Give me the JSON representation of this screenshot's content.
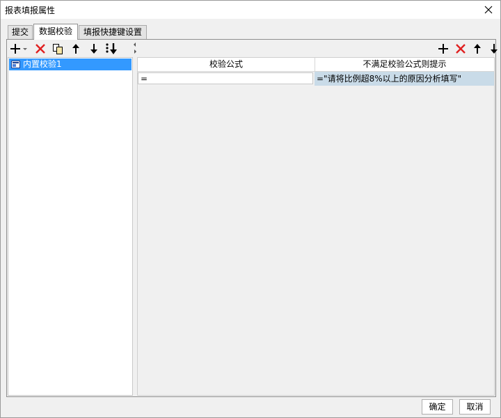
{
  "window": {
    "title": "报表填报属性"
  },
  "tabs": [
    {
      "label": "提交",
      "active": false
    },
    {
      "label": "数据校验",
      "active": true
    },
    {
      "label": "填报快捷键设置",
      "active": false
    }
  ],
  "left_toolbar": {
    "icons": [
      "add-icon",
      "delete-icon",
      "copy-icon",
      "move-up-icon",
      "move-down-icon",
      "move-to-bottom-icon"
    ]
  },
  "tree": {
    "items": [
      {
        "label": "内置校验1",
        "selected": true,
        "icon": "validation-icon"
      }
    ]
  },
  "right_toolbar": {
    "icons": [
      "add-icon",
      "delete-icon",
      "move-up-icon",
      "move-down-icon"
    ]
  },
  "grid": {
    "columns": [
      "校验公式",
      "不满足校验公式则提示"
    ],
    "rows": [
      {
        "formula": "=",
        "message": "=\"请将比例超8%以上的原因分析填写\""
      }
    ]
  },
  "footer": {
    "ok_label": "确定",
    "cancel_label": "取消"
  },
  "colors": {
    "selection": "#3399ff",
    "delete_red": "#e02020",
    "message_cell_bg": "#c9dbe8"
  }
}
